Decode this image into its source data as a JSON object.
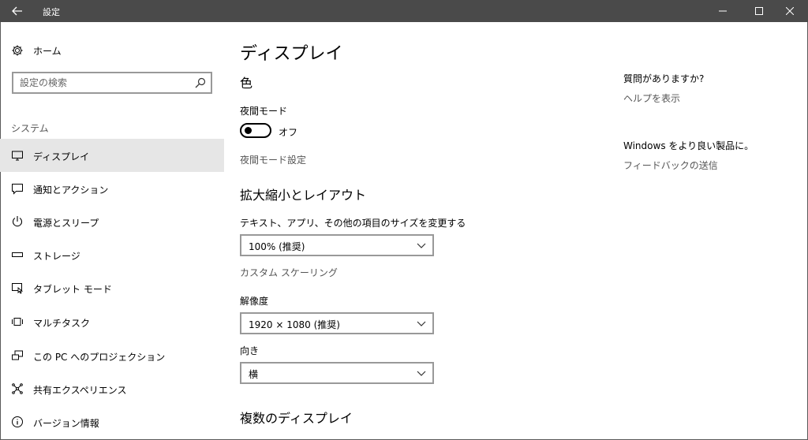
{
  "window": {
    "title": "設定",
    "back_icon": "back-arrow-icon",
    "minimize_icon": "minimize-icon",
    "maximize_icon": "maximize-icon",
    "close_icon": "close-icon",
    "titlebar_color": "#4a4a4a"
  },
  "sidebar": {
    "home_label": "ホーム",
    "home_icon": "gear-icon",
    "search_placeholder": "設定の検索",
    "section_label": "システム",
    "items": [
      {
        "label": "ディスプレイ",
        "icon": "monitor-icon",
        "active": true
      },
      {
        "label": "通知とアクション",
        "icon": "speech-bubble-icon",
        "active": false
      },
      {
        "label": "電源とスリープ",
        "icon": "power-icon",
        "active": false
      },
      {
        "label": "ストレージ",
        "icon": "storage-icon",
        "active": false
      },
      {
        "label": "タブレット モード",
        "icon": "tablet-mode-icon",
        "active": false
      },
      {
        "label": "マルチタスク",
        "icon": "multitask-icon",
        "active": false
      },
      {
        "label": "この PC へのプロジェクション",
        "icon": "projection-icon",
        "active": false
      },
      {
        "label": "共有エクスペリエンス",
        "icon": "shared-experience-icon",
        "active": false
      },
      {
        "label": "バージョン情報",
        "icon": "info-icon",
        "active": false
      }
    ],
    "active_color": "#e6e6e6"
  },
  "main": {
    "page_title": "ディスプレイ",
    "color_heading": "色",
    "night_mode_label": "夜間モード",
    "night_mode_state": "オフ",
    "night_mode_settings_link": "夜間モード設定",
    "scale_heading": "拡大縮小とレイアウト",
    "scale_label": "テキスト、アプリ、その他の項目のサイズを変更する",
    "scale_value": "100% (推奨)",
    "custom_scaling_link": "カスタム スケーリング",
    "resolution_label": "解像度",
    "resolution_value": "1920 × 1080 (推奨)",
    "orientation_label": "向き",
    "orientation_value": "横",
    "multi_display_heading": "複数のディスプレイ"
  },
  "help": {
    "question_heading": "質問がありますか?",
    "help_link": "ヘルプを表示",
    "feedback_heading": "Windows をより良い製品に。",
    "feedback_link": "フィードバックの送信"
  }
}
